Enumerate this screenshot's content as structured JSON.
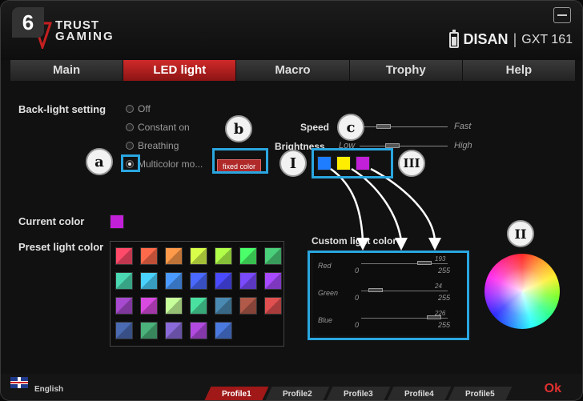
{
  "step_number": "6",
  "brand": {
    "line1": "TRUST",
    "line2": "GAMING"
  },
  "device": {
    "name": "DISAN",
    "separator": "|",
    "model": "GXT 161"
  },
  "tabs": [
    {
      "label": "Main",
      "active": false
    },
    {
      "label": "LED light",
      "active": true
    },
    {
      "label": "Macro",
      "active": false
    },
    {
      "label": "Trophy",
      "active": false
    },
    {
      "label": "Help",
      "active": false
    }
  ],
  "backlight": {
    "label": "Back-light setting",
    "options": [
      {
        "label": "Off",
        "selected": false
      },
      {
        "label": "Constant on",
        "selected": false
      },
      {
        "label": "Breathing",
        "selected": false
      },
      {
        "label": "Multicolor mo...",
        "selected": true
      }
    ],
    "fixed_color_button": "fixed color"
  },
  "speed": {
    "label": "Speed",
    "low": "",
    "high": "Fast",
    "level": 0.35
  },
  "brightness": {
    "label": "Brightness",
    "low": "Low",
    "high": "High",
    "level": 0.35
  },
  "multicolor_swatches": [
    "#1e7cff",
    "#ffee00",
    "#c21fd9"
  ],
  "current_color": {
    "label": "Current color",
    "color": "#c21fd9"
  },
  "preset": {
    "label": "Preset light color",
    "colors": [
      [
        "#ff4a6a",
        "#ff6a4a",
        "#ff9a4a",
        "#d9ff4a",
        "#b2ff4a",
        "#4aff6a",
        "#4acf7a"
      ],
      [
        "#4ad9b2",
        "#4ad2ff",
        "#4a9aff",
        "#4a6aff",
        "#4a4aff",
        "#7a4aff",
        "#a84aff"
      ],
      [
        "#a84acf",
        "#d94ae0",
        "#c7ff9a",
        "#4ae0a0",
        "#4a8ab2",
        "#b25a4a",
        "#e05050"
      ],
      [
        "#4a6ab2",
        "#4ab27a",
        "#8a6ad9",
        "#b24ae0",
        "#4a7ae0"
      ]
    ]
  },
  "custom": {
    "label": "Custom light color",
    "channels": [
      {
        "name": "Red",
        "min": "0",
        "max": "255",
        "value": "193"
      },
      {
        "name": "Green",
        "min": "0",
        "max": "255",
        "value": "24"
      },
      {
        "name": "Blue",
        "min": "0",
        "max": "255",
        "value": "226"
      }
    ]
  },
  "callouts": {
    "a": "a",
    "b": "b",
    "c": "c",
    "I": "I",
    "II": "II",
    "III": "III"
  },
  "footer": {
    "language": "English",
    "profiles": [
      "Profile1",
      "Profile2",
      "Profile3",
      "Profile4",
      "Profile5"
    ],
    "active_profile": 0,
    "ok": "Ok"
  },
  "colors": {
    "accent_red": "#b02020",
    "highlight_blue": "#2aa6e0"
  }
}
